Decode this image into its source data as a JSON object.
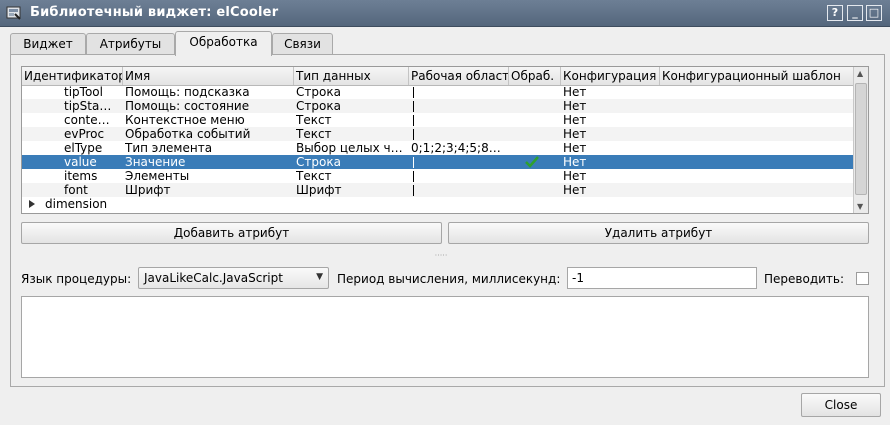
{
  "window": {
    "title": "Библиотечный виджет: elCooler",
    "buttons": {
      "help": "?",
      "minimize": "_",
      "maximize": "□",
      "close": "×"
    }
  },
  "tabs": [
    "Виджет",
    "Атрибуты",
    "Обработка",
    "Связи"
  ],
  "active_tab": "Обработка",
  "table": {
    "columns": [
      "Идентификатор",
      "Имя",
      "Тип данных",
      "Рабочая область",
      "Обраб.",
      "Конфигурация",
      "Конфигурационный шаблон"
    ],
    "rows": [
      {
        "id": "tipTool",
        "name": "Помощь: подсказка",
        "type": "Строка",
        "work": "",
        "proc": false,
        "config": "Нет",
        "tmpl": ""
      },
      {
        "id": "tipSta…",
        "name": "Помощь: состояние",
        "type": "Строка",
        "work": "",
        "proc": false,
        "config": "Нет",
        "tmpl": ""
      },
      {
        "id": "conte…",
        "name": "Контекстное меню",
        "type": "Текст",
        "work": "",
        "proc": false,
        "config": "Нет",
        "tmpl": ""
      },
      {
        "id": "evProc",
        "name": "Обработка событий",
        "type": "Текст",
        "work": "",
        "proc": false,
        "config": "Нет",
        "tmpl": ""
      },
      {
        "id": "elType",
        "name": "Тип элемента",
        "type": "Выбор целых ч…",
        "work": "0;1;2;3;4;5;8…",
        "proc": false,
        "config": "Нет",
        "tmpl": ""
      },
      {
        "id": "value",
        "name": "Значение",
        "type": "Строка",
        "work": "",
        "proc": true,
        "config": "Нет",
        "tmpl": ""
      },
      {
        "id": "items",
        "name": "Элементы",
        "type": "Текст",
        "work": "",
        "proc": false,
        "config": "Нет",
        "tmpl": ""
      },
      {
        "id": "font",
        "name": "Шрифт",
        "type": "Шрифт",
        "work": "",
        "proc": false,
        "config": "Нет",
        "tmpl": ""
      }
    ],
    "group": {
      "label": "dimension"
    },
    "selected_row": "value"
  },
  "buttons": {
    "add_attr": "Добавить атрибут",
    "del_attr": "Удалить атрибут",
    "close": "Close"
  },
  "procedure": {
    "lang_label": "Язык процедуры:",
    "lang_value": "JavaLikeCalc.JavaScript",
    "period_label": "Период вычисления, миллисекунд:",
    "period_value": "-1",
    "translate_label": "Переводить:",
    "translate_checked": false,
    "code": ""
  },
  "colors": {
    "selection": "#3a7cb8",
    "titlebar": "#5d6f86",
    "check": "#2ea12e"
  },
  "icons": {
    "app": "library-widget-icon",
    "check": "checkmark-icon",
    "expand": "triangle-right-icon"
  }
}
